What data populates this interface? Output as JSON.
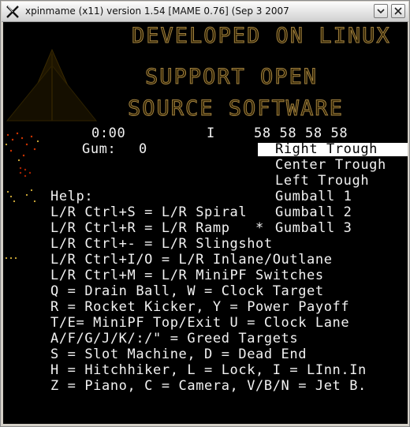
{
  "window": {
    "title": "xpinmame (x11) version 1.54 [MAME 0.76] (Sep  3 2007",
    "icon": "x-logo-icon",
    "buttons": [
      "minimize-icon",
      "close-icon"
    ]
  },
  "dmd": {
    "line1": "DEVELOPED ON LINUX",
    "line2": "SUPPORT OPEN",
    "line3": "SOURCE SOFTWARE",
    "color": "#a28240"
  },
  "status": {
    "time": "0:00",
    "marker": "I",
    "values": "58 58 58 58",
    "gum_label": "Gum:",
    "gum_value": "0"
  },
  "menu": {
    "items": [
      "Right Trough",
      "Center Trough",
      "Left Trough",
      "Gumball 1",
      "Gumball 2",
      "Gumball 3"
    ],
    "selected_index": 0
  },
  "help": {
    "title": "Help:",
    "lines": [
      "L/R Ctrl+S = L/R Spiral",
      "L/R Ctrl+R = L/R Ramp",
      "L/R Ctrl+- = L/R Slingshot",
      "L/R Ctrl+I/O = L/R Inlane/Outlane",
      "L/R Ctrl+M = L/R MiniPF Switches",
      "Q = Drain Ball, W = Clock Target",
      "R = Rocket Kicker, Y = Power Payoff",
      "T/E= MiniPF Top/Exit U = Clock Lane",
      "A/F/G/J/K/:/\" = Greed Targets",
      "S = Slot Machine, D = Dead End",
      "H = Hitchhiker, L = Lock, I = LInn.In",
      "Z = Piano, C = Camera, V/B/N = Jet B."
    ],
    "star": "*"
  }
}
